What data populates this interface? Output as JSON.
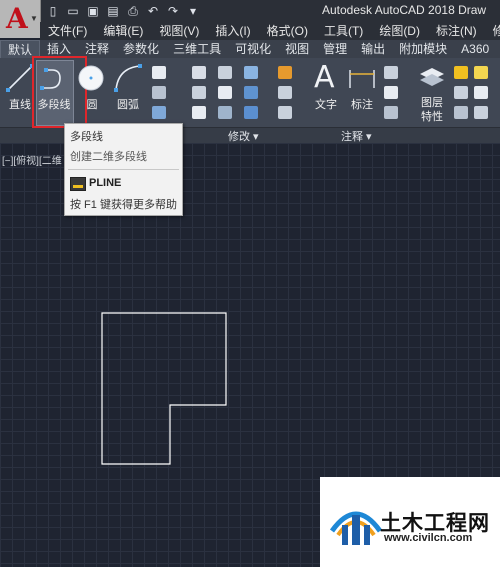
{
  "app": {
    "logo_letter": "A",
    "title": "Autodesk AutoCAD 2018   Draw"
  },
  "quick_access": {
    "icons": [
      "new-icon",
      "open-icon",
      "save-icon",
      "save-as-icon",
      "print-icon",
      "undo-icon",
      "redo-icon",
      "dropdown-icon"
    ]
  },
  "menu": {
    "items": [
      "文件(F)",
      "编辑(E)",
      "视图(V)",
      "插入(I)",
      "格式(O)",
      "工具(T)",
      "绘图(D)",
      "标注(N)",
      "修"
    ]
  },
  "ribbon_tabs": {
    "items": [
      "默认",
      "插入",
      "注释",
      "参数化",
      "三维工具",
      "可视化",
      "视图",
      "管理",
      "输出",
      "附加模块",
      "A360"
    ],
    "active_index": 0
  },
  "ribbon": {
    "draw_tools": {
      "line": "直线",
      "polyline": "多段线",
      "circle": "圆",
      "arc": "圆弧"
    },
    "annotation_tools": {
      "text": "文字",
      "dimension": "标注"
    },
    "layer_tools": {
      "layer_properties": "图层\n特性",
      "layer_properties_line1": "图层",
      "layer_properties_line2": "特性"
    },
    "panels": {
      "modify": "修改 ▾",
      "annotation": "注释 ▾"
    }
  },
  "tooltip": {
    "title": "多段线",
    "description": "创建二维多段线",
    "command": "PLINE",
    "help": "按 F1 键获得更多帮助"
  },
  "viewport": {
    "label": "[−][俯视][二维",
    "background": "#1f2431",
    "shape_stroke": "#ffffff"
  },
  "watermark": {
    "name": "土木工程网",
    "url": "www.civilcn.com"
  },
  "colors": {
    "highlight": "#e0262b",
    "accent_red": "#c0101a"
  }
}
